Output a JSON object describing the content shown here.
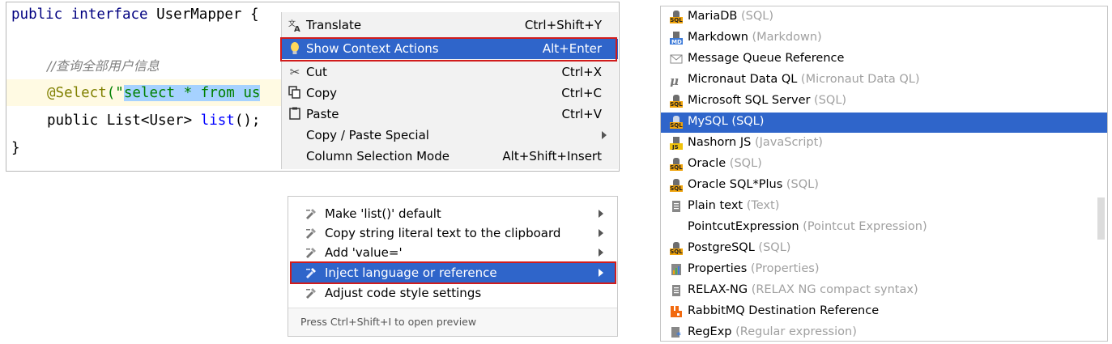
{
  "editor": {
    "line1_kw": "public interface",
    "line1_name": " UserMapper {",
    "comment": "//查询全部用户信息",
    "annotation": "@Select",
    "paren_open": "(\"",
    "selected_sql": "select * from us",
    "method_prefix": "public ",
    "method_type": "List<User>",
    "method_name": " list",
    "method_suffix": "();",
    "closing_brace": "}"
  },
  "context_menu": {
    "items": [
      {
        "icon": "translate-icon",
        "label": "Translate",
        "shortcut": "Ctrl+Shift+Y"
      },
      {
        "icon": "lightbulb-icon",
        "label": "Show Context Actions",
        "shortcut": "Alt+Enter",
        "selected": true
      },
      {
        "icon": "scissors-icon",
        "label": "Cut",
        "shortcut": "Ctrl+X"
      },
      {
        "icon": "copy-icon",
        "label": "Copy",
        "shortcut": "Ctrl+C"
      },
      {
        "icon": "paste-icon",
        "label": "Paste",
        "shortcut": "Ctrl+V"
      },
      {
        "icon": "",
        "label": "Copy / Paste Special",
        "shortcut": ""
      },
      {
        "icon": "",
        "label": "Column Selection Mode",
        "shortcut": "Alt+Shift+Insert"
      }
    ]
  },
  "intentions": {
    "items": [
      {
        "label": "Make 'list()' default"
      },
      {
        "label": "Copy string literal text to the clipboard"
      },
      {
        "label": "Add 'value='"
      },
      {
        "label": "Inject language or reference",
        "selected": true
      },
      {
        "label": "Adjust code style settings"
      }
    ],
    "footer": "Press Ctrl+Shift+I to open preview"
  },
  "languages": {
    "items": [
      {
        "icon": "sql-icon",
        "name": "MariaDB",
        "sub": " (SQL)"
      },
      {
        "icon": "markdown-icon",
        "name": "Markdown",
        "sub": " (Markdown)"
      },
      {
        "icon": "message-queue-icon",
        "name": "Message Queue Reference",
        "sub": ""
      },
      {
        "icon": "micronaut-icon",
        "name": "Micronaut Data QL",
        "sub": " (Micronaut Data QL)"
      },
      {
        "icon": "sql-icon",
        "name": "Microsoft SQL Server",
        "sub": " (SQL)"
      },
      {
        "icon": "sql-icon",
        "name": "MySQL",
        "sub": " (SQL)",
        "selected": true
      },
      {
        "icon": "javascript-icon",
        "name": "Nashorn JS",
        "sub": " (JavaScript)"
      },
      {
        "icon": "sql-icon",
        "name": "Oracle",
        "sub": " (SQL)"
      },
      {
        "icon": "sql-icon",
        "name": "Oracle SQL*Plus",
        "sub": " (SQL)"
      },
      {
        "icon": "text-file-icon",
        "name": "Plain text",
        "sub": " (Text)"
      },
      {
        "icon": "",
        "name": "PointcutExpression",
        "sub": " (Pointcut Expression)"
      },
      {
        "icon": "sql-icon",
        "name": "PostgreSQL",
        "sub": " (SQL)"
      },
      {
        "icon": "properties-icon",
        "name": "Properties",
        "sub": " (Properties)"
      },
      {
        "icon": "relaxng-icon",
        "name": "RELAX-NG",
        "sub": " (RELAX NG compact syntax)"
      },
      {
        "icon": "rabbitmq-icon",
        "name": "RabbitMQ Destination Reference",
        "sub": ""
      },
      {
        "icon": "regexp-icon",
        "name": "RegExp",
        "sub": " (Regular expression)"
      }
    ]
  },
  "colors": {
    "selection": "#2f65ca",
    "highlight_box": "#d11c1c",
    "sql_tag": "#f0a30a"
  }
}
